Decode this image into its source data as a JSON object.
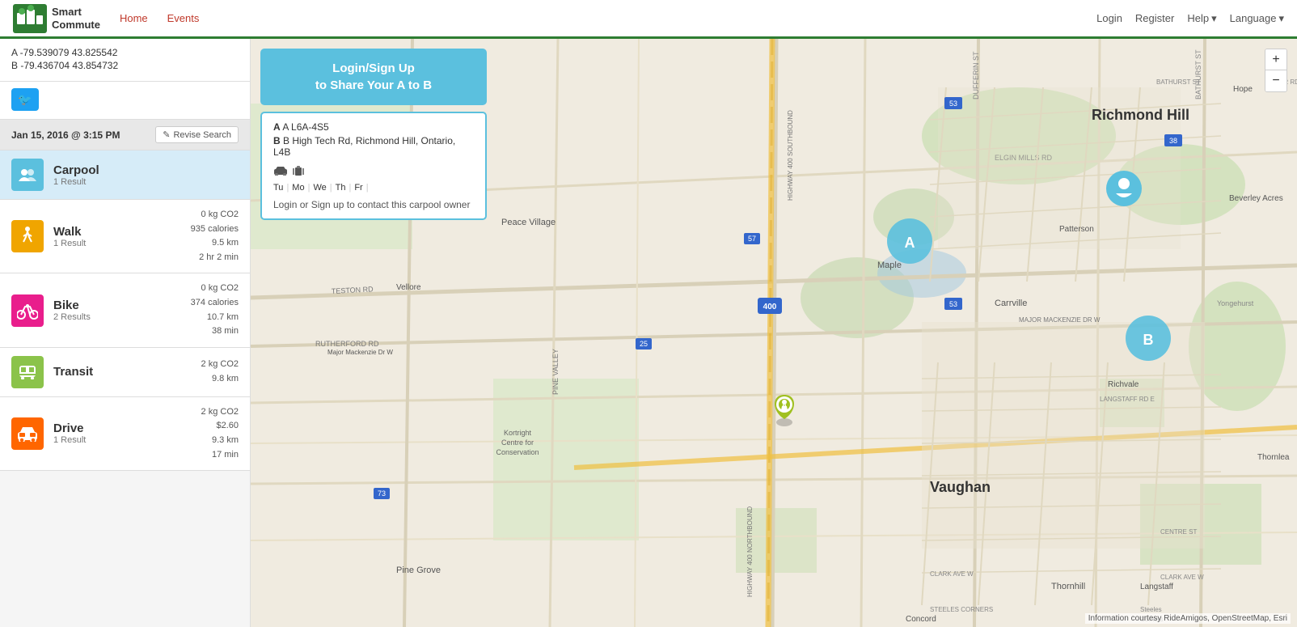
{
  "app": {
    "title": "Smart Commute",
    "logo_line1": "Smart",
    "logo_line2": "Commute"
  },
  "navbar": {
    "home_label": "Home",
    "events_label": "Events",
    "login_label": "Login",
    "register_label": "Register",
    "help_label": "Help",
    "language_label": "Language"
  },
  "sidebar": {
    "coord_a": "A  -79.539079  43.825542",
    "coord_b": "B  -79.436704  43.854732",
    "date": "Jan 15, 2016 @ 3:15 PM",
    "revise_search_label": "Revise Search",
    "transport_items": [
      {
        "id": "carpool",
        "name": "Carpool",
        "result": "1 Result",
        "stats": "",
        "active": true
      },
      {
        "id": "walk",
        "name": "Walk",
        "result": "1 Result",
        "stats": "0 kg CO2\n935 calories\n9.5 km\n2 hr 2 min"
      },
      {
        "id": "bike",
        "name": "Bike",
        "result": "2 Results",
        "stats": "0 kg CO2\n374 calories\n10.7 km\n38 min"
      },
      {
        "id": "transit",
        "name": "Transit",
        "result": "",
        "stats": "2 kg CO2\n9.8 km"
      },
      {
        "id": "drive",
        "name": "Drive",
        "result": "1 Result",
        "stats": "2 kg CO2\n$2.60\n9.3 km\n17 min"
      }
    ]
  },
  "map_panel": {
    "login_btn_line1": "Login/Sign Up",
    "login_btn_line2": "to Share Your A to B",
    "carpool_card": {
      "point_a": "A  L6A-4S5",
      "point_b": "B  High Tech Rd, Richmond Hill, Ontario, L4B",
      "days": [
        "Tu",
        "Mo",
        "We",
        "Th",
        "Fr"
      ],
      "contact_msg": "Login or Sign up to contact this carpool owner"
    }
  },
  "map": {
    "place_richmond_hill": "Richmond Hill",
    "place_vaughan": "Vaughan",
    "marker_a_label": "A",
    "marker_b_label": "B",
    "attribution": "Information courtesy RideAmigos, OpenStreetMap, Esri"
  },
  "icons": {
    "carpool": "👥",
    "walk": "🚶",
    "bike": "🚲",
    "transit": "🚌",
    "drive": "🚗",
    "twitter": "🐦",
    "edit": "✎",
    "car": "🚗",
    "luggage": "🎒",
    "person": "👤",
    "zoom_in": "+",
    "zoom_out": "−"
  }
}
